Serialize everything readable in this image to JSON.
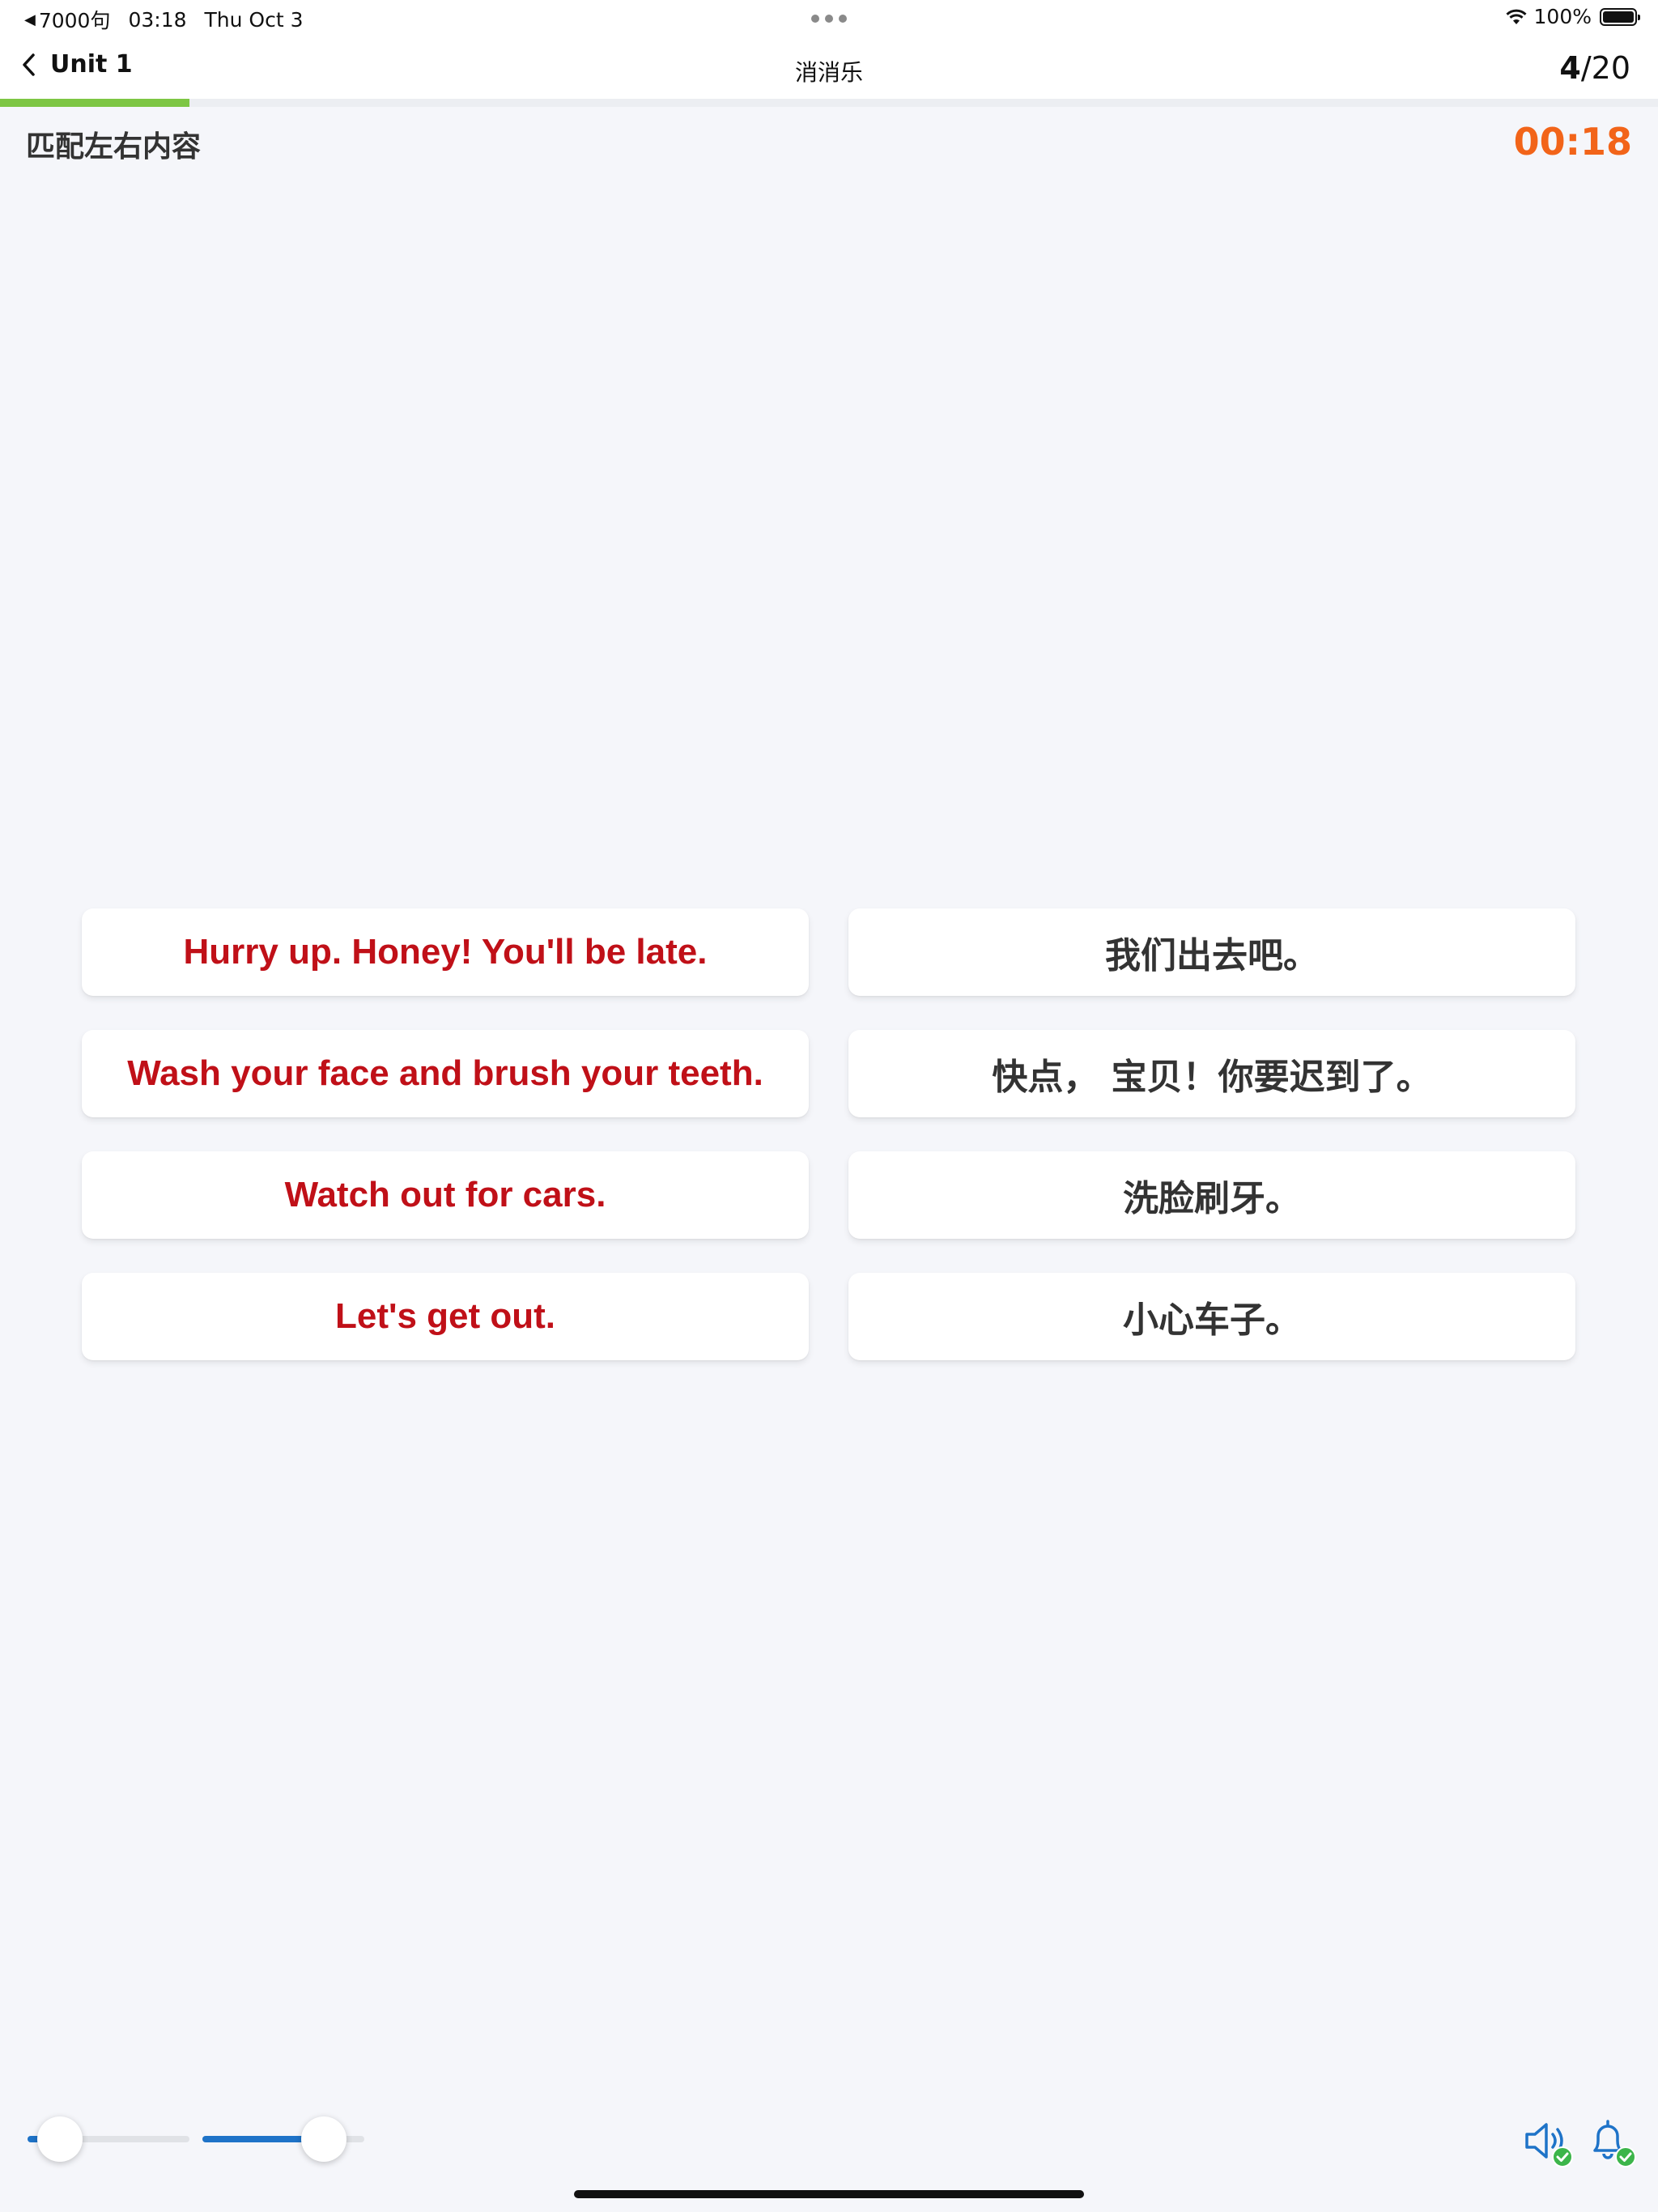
{
  "status_bar": {
    "carrier": "7000句",
    "time": "03:18",
    "date": "Thu Oct 3",
    "battery": "100%"
  },
  "nav": {
    "back_label": "Unit 1",
    "title": "消消乐",
    "counter_current": "4",
    "counter_total": "/20",
    "progress_fraction": 0.2
  },
  "instruction": "匹配左右内容",
  "timer": "00:18",
  "left_cards": [
    "Hurry up. Honey! You'll be late.",
    "Wash your face and brush your teeth.",
    "Watch out for cars.",
    "Let's get out."
  ],
  "right_cards": [
    "我们出去吧。",
    "快点， 宝贝！你要迟到了。",
    "洗脸刷牙。",
    "小心车子。"
  ],
  "controls": {
    "slider_1_value": 0.2,
    "slider_2_value": 0.75,
    "speaker_icon": "speaker-check-icon",
    "bell_icon": "bell-check-icon"
  },
  "colors": {
    "english_text": "#c01018",
    "timer": "#f26419",
    "progress": "#7dc644",
    "slider_fill": "#1e73c8",
    "check_badge": "#3cb54a"
  }
}
